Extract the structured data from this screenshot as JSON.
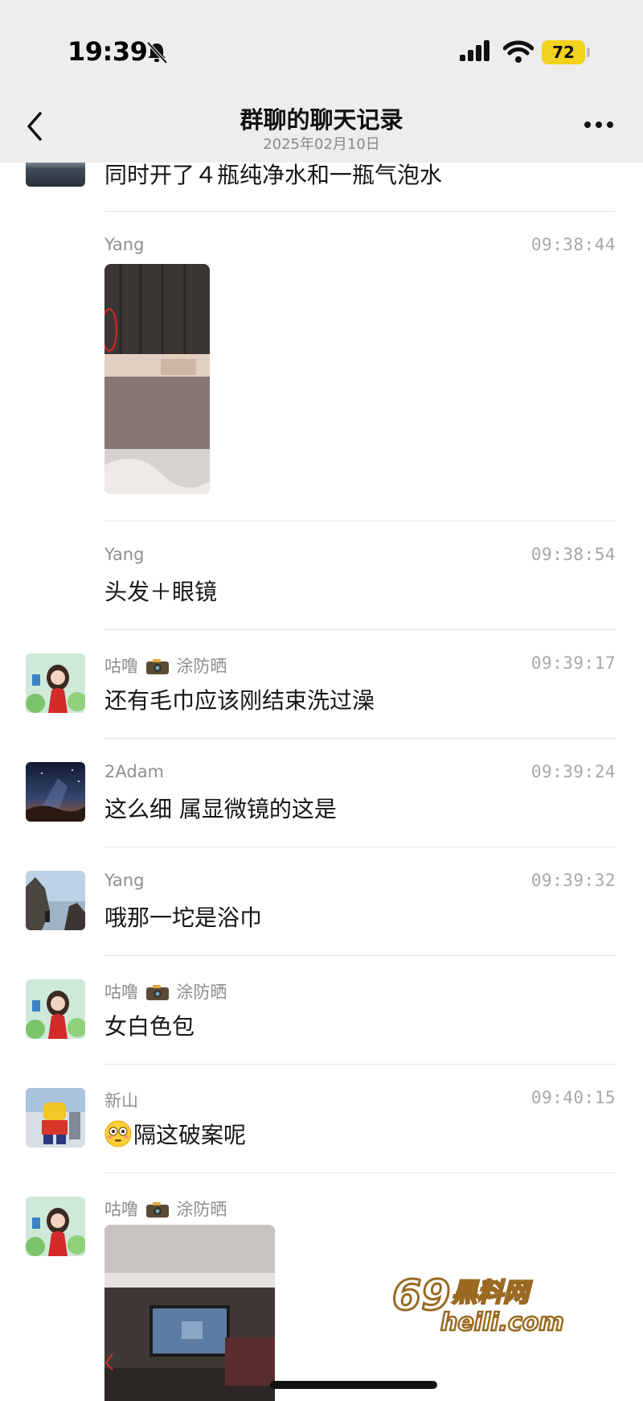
{
  "status_bar": {
    "time": "19:39",
    "battery": "72",
    "icons": [
      "bell-muted-icon",
      "signal-icon",
      "wifi-icon",
      "battery-icon"
    ]
  },
  "nav": {
    "title": "群聊的聊天记录",
    "subtitle": "2025年02月10日",
    "back_icon": "chevron-left-icon",
    "more_icon": "more-icon"
  },
  "messages": [
    {
      "sender": "",
      "time": "",
      "text": "同时开了４瓶纯净水和一瓶气泡水",
      "avatar": "seaside-avatar"
    },
    {
      "sender": "Yang",
      "time": "09:38:44",
      "text": "",
      "attachment": "photo"
    },
    {
      "sender": "Yang",
      "time": "09:38:54",
      "text": "头发＋眼镜"
    },
    {
      "sender_prefix": "咕噜",
      "sender_suffix": "涂防晒",
      "time": "09:39:17",
      "text": "还有毛巾应该刚结束洗过澡",
      "avatar": "girl-avatar"
    },
    {
      "sender": "2Adam",
      "time": "09:39:24",
      "text": "这么细 属显微镜的这是",
      "avatar": "nightsky-avatar"
    },
    {
      "sender": "Yang",
      "time": "09:39:32",
      "text": "哦那一坨是浴巾",
      "avatar": "seaside-avatar"
    },
    {
      "sender_prefix": "咕噜",
      "sender_suffix": "涂防晒",
      "time": "",
      "text": "女白色包",
      "avatar": "girl-avatar"
    },
    {
      "sender": "新山",
      "time": "09:40:15",
      "text": "隔这破案呢",
      "avatar": "lego-avatar",
      "emoji": "flushed-face-icon"
    },
    {
      "sender_prefix": "咕噜",
      "sender_suffix": "涂防晒",
      "time": "",
      "text": "",
      "avatar": "girl-avatar",
      "attachment": "photo"
    }
  ],
  "watermark": {
    "line1": "69黑料网",
    "line2": "heili.com"
  }
}
